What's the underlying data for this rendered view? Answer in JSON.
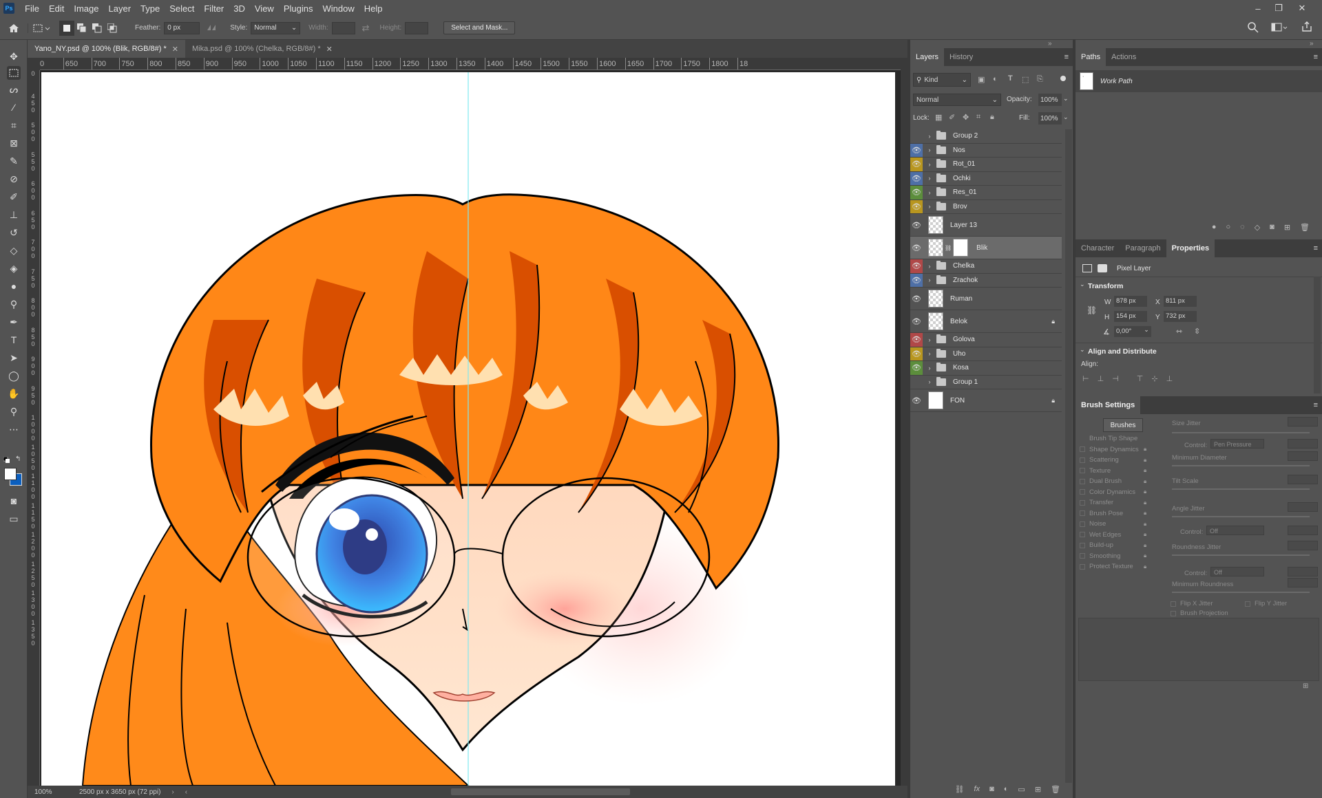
{
  "app": {
    "logo": "Ps"
  },
  "menu": [
    "File",
    "Edit",
    "Image",
    "Layer",
    "Type",
    "Select",
    "Filter",
    "3D",
    "View",
    "Plugins",
    "Window",
    "Help"
  ],
  "window_controls": {
    "minimize": "–",
    "restore": "❐",
    "close": "✕"
  },
  "options": {
    "feather_label": "Feather:",
    "feather_value": "0 px",
    "style_label": "Style:",
    "style_value": "Normal",
    "width_label": "Width:",
    "height_label": "Height:",
    "select_mask": "Select and Mask..."
  },
  "doc_tabs": [
    {
      "label": "Yano_NY.psd @ 100% (Blik, RGB/8#) *",
      "active": true
    },
    {
      "label": "Mika.psd @ 100% (Chelka, RGB/8#) *",
      "active": false
    }
  ],
  "ruler_h": [
    "0",
    "650",
    "700",
    "750",
    "800",
    "850",
    "900",
    "950",
    "1000",
    "1050",
    "1100",
    "1150",
    "1200",
    "1250",
    "1300",
    "1350",
    "1400",
    "1450",
    "1500",
    "1550",
    "1600",
    "1650",
    "1700",
    "1750",
    "1800",
    "18"
  ],
  "ruler_v": [
    "0",
    "4\n5\n0",
    "5\n0\n0",
    "5\n5\n0",
    "6\n0\n0",
    "6\n5\n0",
    "7\n0\n0",
    "7\n5\n0",
    "8\n0\n0",
    "8\n5\n0",
    "9\n0\n0",
    "9\n5\n0",
    "1\n0\n0\n0",
    "1\n0\n5\n0",
    "1\n1\n0\n0",
    "1\n1\n5\n0",
    "1\n2\n0\n0",
    "1\n2\n5\n0",
    "1\n3\n0\n0",
    "1\n3\n5\n0"
  ],
  "status": {
    "zoom": "100%",
    "doc_size": "2500 px x 3650 px (72 ppi)"
  },
  "layers_panel": {
    "tabs": [
      "Layers",
      "History"
    ],
    "kind": "Kind",
    "blend": "Normal",
    "opacity_label": "Opacity:",
    "opacity": "100%",
    "lock_label": "Lock:",
    "fill_label": "Fill:",
    "fill": "100%",
    "layers": [
      {
        "name": "Group 2",
        "type": "group",
        "visible": false,
        "color": ""
      },
      {
        "name": "Nos",
        "type": "group",
        "visible": true,
        "color": "#4e6fa6"
      },
      {
        "name": "Rot_01",
        "type": "group",
        "visible": true,
        "color": "#b8961f"
      },
      {
        "name": "Ochki",
        "type": "group",
        "visible": true,
        "color": "#4e6fa6"
      },
      {
        "name": "Res_01",
        "type": "group",
        "visible": true,
        "color": "#5c8e3c"
      },
      {
        "name": "Brov",
        "type": "group",
        "visible": true,
        "color": "#b8961f"
      },
      {
        "name": "Layer 13",
        "type": "pixel",
        "visible": true,
        "color": ""
      },
      {
        "name": "Blik",
        "type": "masked",
        "visible": true,
        "color": "",
        "selected": true
      },
      {
        "name": "Chelka",
        "type": "group",
        "visible": true,
        "color": "#b04848"
      },
      {
        "name": "Zrachok",
        "type": "group",
        "visible": true,
        "color": "#4e6fa6"
      },
      {
        "name": "Ruman",
        "type": "pixel",
        "visible": true,
        "color": ""
      },
      {
        "name": "Belok",
        "type": "pixel",
        "visible": true,
        "color": "",
        "locked": true
      },
      {
        "name": "Golova",
        "type": "group",
        "visible": true,
        "color": "#b04848"
      },
      {
        "name": "Uho",
        "type": "group",
        "visible": true,
        "color": "#b8961f"
      },
      {
        "name": "Kosa",
        "type": "group",
        "visible": true,
        "color": "#5c8e3c"
      },
      {
        "name": "Group 1",
        "type": "group",
        "visible": false,
        "color": ""
      },
      {
        "name": "FON",
        "type": "white",
        "visible": true,
        "color": "",
        "locked": true
      }
    ]
  },
  "paths_panel": {
    "tabs": [
      "Paths",
      "Actions"
    ],
    "work_path": "Work Path"
  },
  "properties_panel": {
    "tabs": [
      "Character",
      "Paragraph",
      "Properties"
    ],
    "layer_kind": "Pixel Layer",
    "transform_title": "Transform",
    "w_label": "W",
    "w": "878 px",
    "x_label": "X",
    "x": "811 px",
    "h_label": "H",
    "h": "154 px",
    "y_label": "Y",
    "y": "732 px",
    "angle": "0,00°",
    "align_title": "Align and Distribute",
    "align_label": "Align:"
  },
  "brush_settings": {
    "title": "Brush Settings",
    "brushes_btn": "Brushes",
    "items": [
      "Brush Tip Shape",
      "Shape Dynamics",
      "Scattering",
      "Texture",
      "Dual Brush",
      "Color Dynamics",
      "Transfer",
      "Brush Pose",
      "Noise",
      "Wet Edges",
      "Build-up",
      "Smoothing",
      "Protect Texture"
    ],
    "size_jitter": "Size Jitter",
    "control_label": "Control:",
    "control1": "Pen Pressure",
    "min_diameter": "Minimum Diameter",
    "tilt_scale": "Tilt Scale",
    "angle_jitter": "Angle Jitter",
    "control2": "Off",
    "roundness_jitter": "Roundness Jitter",
    "control3": "Off",
    "min_roundness": "Minimum Roundness",
    "flip_x": "Flip X Jitter",
    "flip_y": "Flip Y Jitter",
    "brush_projection": "Brush Projection"
  }
}
